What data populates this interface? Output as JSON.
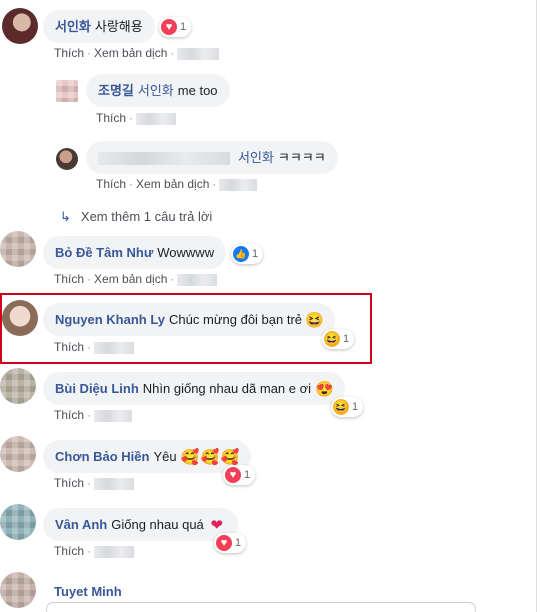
{
  "comments": [
    {
      "author": "서인화",
      "text": "사랑해용",
      "react_count": "1",
      "like": "Thích",
      "translate": "Xem bản dịch"
    },
    {
      "author": "조명길",
      "text": "me too",
      "tag": "서인화",
      "like": "Thích"
    },
    {
      "author": "",
      "text": "ㅋㅋㅋㅋ",
      "tag": "서인화",
      "like": "Thích",
      "translate": "Xem bản dịch"
    },
    {
      "author": "Bỏ Đề Tâm Như",
      "text": "Wowwww",
      "react_count": "1",
      "like": "Thích",
      "translate": "Xem bản dịch"
    },
    {
      "author": "Nguyen Khanh Ly",
      "text": "Chúc mừng đôi bạn trẻ",
      "react_count": "1",
      "like": "Thích"
    },
    {
      "author": "Bùi Diệu Linh",
      "text": "Nhìn giống nhau dã man e ơi",
      "react_count": "1",
      "like": "Thích"
    },
    {
      "author": "Chơn Bảo Hiền",
      "text": "Yêu",
      "react_count": "1",
      "like": "Thích"
    },
    {
      "author": "Vân Anh",
      "text": "Giống nhau quá",
      "react_count": "1",
      "like": "Thích"
    },
    {
      "author": "Tuyet Minh"
    }
  ],
  "more_replies": "Xem thêm 1 câu trả lời",
  "icons": {
    "reply_arrow": "reply-arrow-icon",
    "heart": "heart-reaction-icon",
    "like": "like-reaction-icon",
    "haha": "haha-reaction-icon",
    "love_eyes": "heart-eyes-icon"
  },
  "colors": {
    "author": "#385898",
    "highlight": "#d0021b",
    "bubble": "#f2f3f5"
  }
}
